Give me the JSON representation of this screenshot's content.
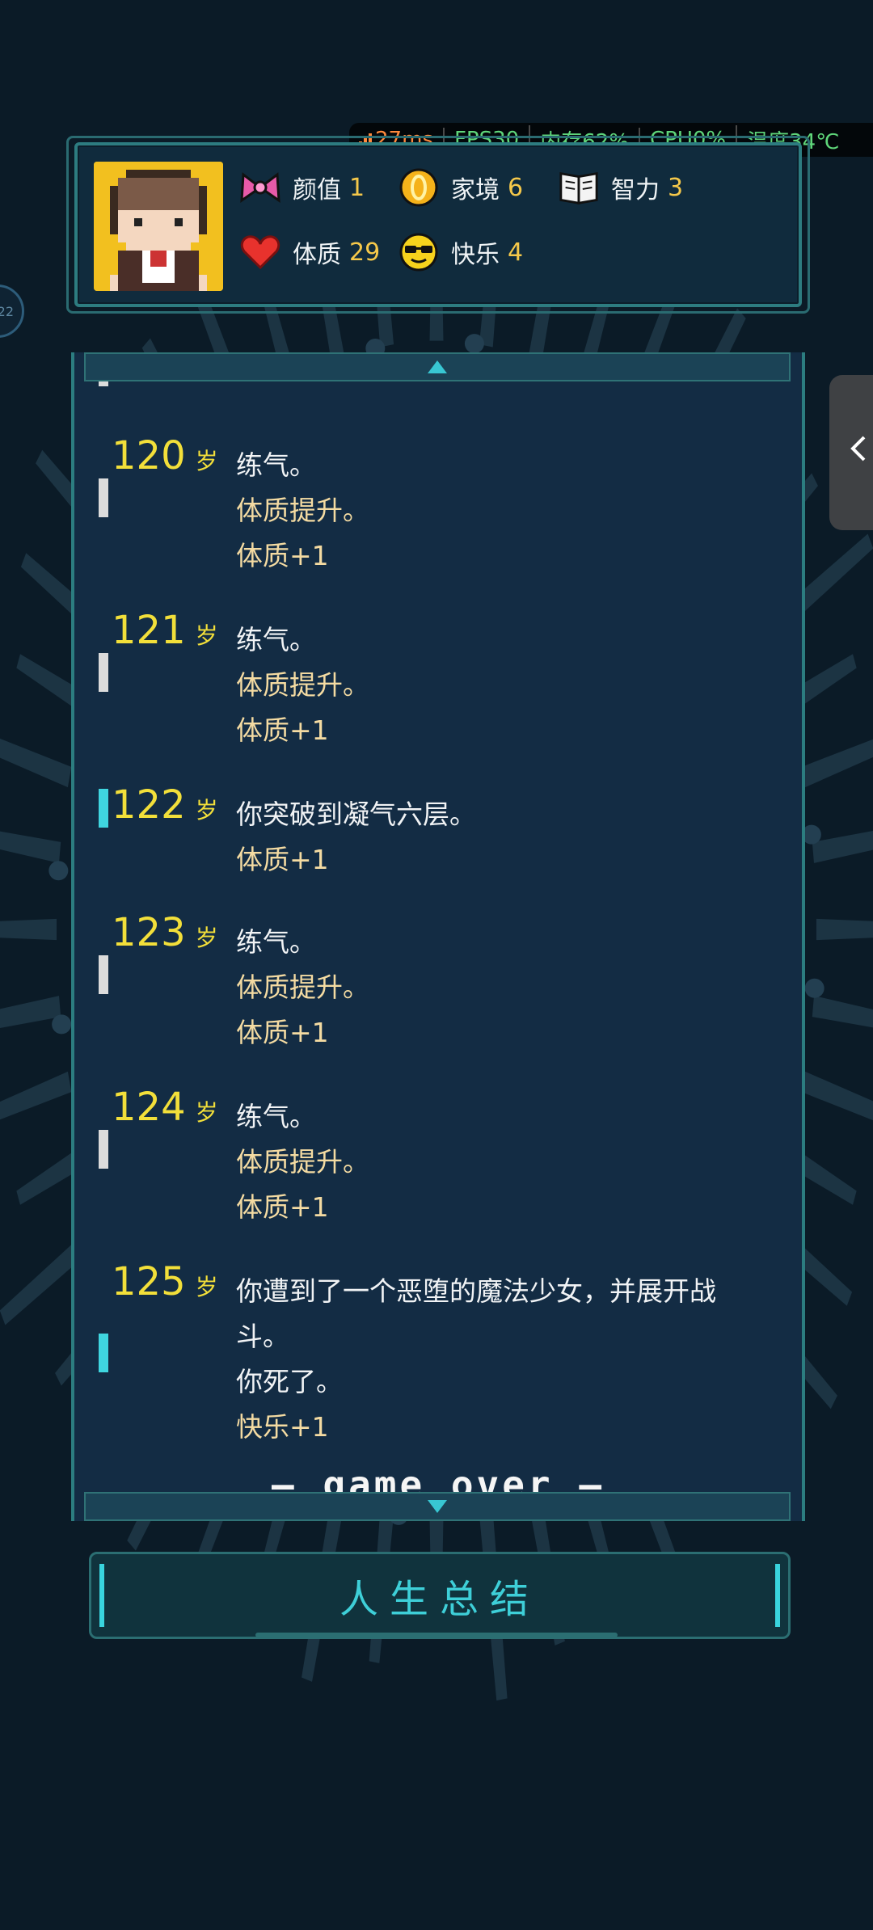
{
  "perf": {
    "ping": "27ms",
    "fps": "FPS30",
    "memory": "内存62%",
    "cpu": "CPU0%",
    "temp": "温度34℃"
  },
  "stats": {
    "appearance": {
      "label": "颜值",
      "value": "1",
      "icon": "bow-icon"
    },
    "family": {
      "label": "家境",
      "value": "6",
      "icon": "coin-icon"
    },
    "intelligence": {
      "label": "智力",
      "value": "3",
      "icon": "book-icon"
    },
    "constitution": {
      "label": "体质",
      "value": "29",
      "icon": "heart-icon"
    },
    "happiness": {
      "label": "快乐",
      "value": "4",
      "icon": "sunglasses-face-icon"
    }
  },
  "side_badge": "22",
  "unit": "岁",
  "entries": [
    {
      "age": "120",
      "lines": [
        "练气。",
        "体质提升。",
        "体质+1"
      ],
      "marker": "white"
    },
    {
      "age": "121",
      "lines": [
        "练气。",
        "体质提升。",
        "体质+1"
      ],
      "marker": "white"
    },
    {
      "age": "122",
      "lines": [
        "你突破到凝气六层。",
        "体质+1"
      ],
      "marker": "cyan"
    },
    {
      "age": "123",
      "lines": [
        "练气。",
        "体质提升。",
        "体质+1"
      ],
      "marker": "white"
    },
    {
      "age": "124",
      "lines": [
        "练气。",
        "体质提升。",
        "体质+1"
      ],
      "marker": "white"
    },
    {
      "age": "125",
      "lines": [
        "你遭到了一个恶堕的魔法少女，并展开战",
        "斗。",
        "你死了。",
        "快乐+1"
      ],
      "marker": "cyan"
    }
  ],
  "game_over": "— game over —",
  "summary_button": "人生总结"
}
